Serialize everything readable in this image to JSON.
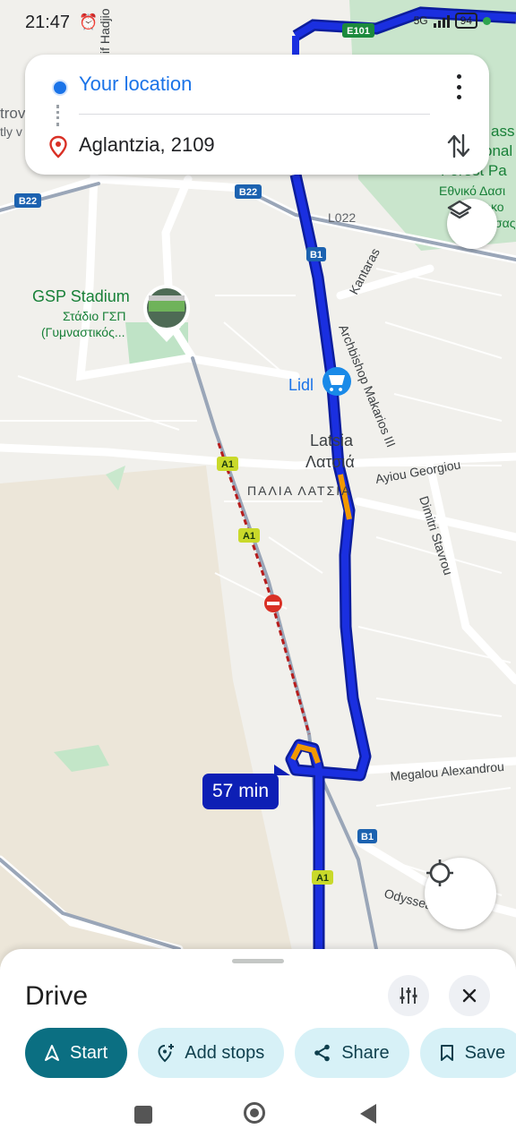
{
  "status_bar": {
    "time": "21:47",
    "network": "5G",
    "battery": "94"
  },
  "directions": {
    "origin": "Your location",
    "destination": "Aglantzia, 2109"
  },
  "map": {
    "road_badges": [
      "E101",
      "B22",
      "B22",
      "B1",
      "A1",
      "A1",
      "B1",
      "A1"
    ],
    "road_names": [
      "L022",
      "Kantaras",
      "Archbishop Makarios III",
      "Ayiou Georgiou",
      "Dimitri Stavrou",
      "Megalou Alexandrou",
      "Odyssea"
    ],
    "places": {
      "stadium_en": "GSP Stadium",
      "stadium_gr_1": "Στάδιο ΓΣΠ",
      "stadium_gr_2": "(Γυμναστικός...",
      "store": "Lidl",
      "town_en": "Latsia",
      "town_gr": "Λατσιά",
      "old_town_gr": "ΠΑΛΙΑ ΛΑΤΣΙΑ",
      "forest_1": "ass",
      "forest_2": "onal",
      "forest_3": "Forest Pa",
      "forest_4": "Εθνικό Δασι",
      "forest_5": "ρκο",
      "forest_6": "σας",
      "edge_1": "trov",
      "edge_2": "tly v",
      "edge_3": "if Hadjio"
    },
    "eta": "57 min"
  },
  "sheet": {
    "title": "Drive",
    "chips": {
      "start": "Start",
      "add_stops": "Add stops",
      "share": "Share",
      "save": "Save"
    }
  },
  "colors": {
    "route": "#1a2fe0",
    "route_slow": "#f29900",
    "accent": "#0b6f82",
    "chip_bg": "#d7f1f7"
  }
}
